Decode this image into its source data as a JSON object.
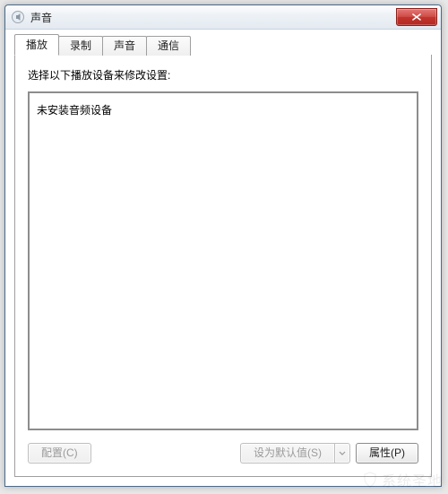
{
  "window": {
    "title": "声音"
  },
  "tabs": {
    "t0": "播放",
    "t1": "录制",
    "t2": "声音",
    "t3": "通信",
    "active_index": 0
  },
  "page": {
    "instruction": "选择以下播放设备来修改设置:",
    "empty_message": "未安装音频设备"
  },
  "buttons": {
    "configure": "配置(C)",
    "set_default": "设为默认值(S)",
    "properties": "属性(P)"
  },
  "icons": {
    "app": "sound-icon",
    "close": "close-icon",
    "dropdown": "chevron-down-icon"
  },
  "watermark": "系统圣地"
}
